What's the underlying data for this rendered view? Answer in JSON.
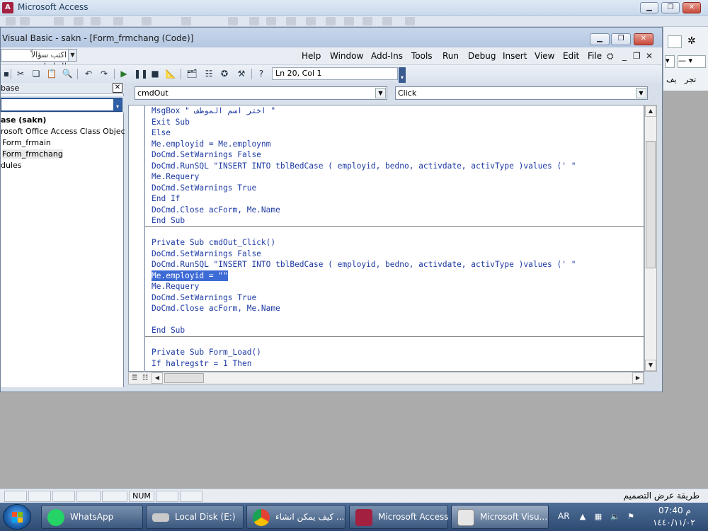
{
  "access": {
    "title": "Microsoft Access"
  },
  "vbe": {
    "title": "Visual Basic - sakn - [Form_frmchang (Code)]",
    "ask_placeholder": "اكتب سؤالاً للتعليمات",
    "menu": [
      "Help",
      "Window",
      "Add-Ins",
      "Tools",
      "Run",
      "Debug",
      "Insert",
      "View",
      "Edit",
      "File"
    ],
    "position": "Ln 20, Col 1"
  },
  "project": {
    "header": "base",
    "items": [
      "ase (sakn)",
      "rosoft Office Access Class Objects",
      "Form_frmain",
      "Form_frmchang",
      "dules"
    ]
  },
  "code": {
    "object_combo": "cmdOut",
    "procedure_combo": "Click",
    "lines": [
      "MsgBox \" اختر اسم الموظف \"",
      "Exit Sub",
      "Else",
      "Me.employid = Me.employnm",
      "DoCmd.SetWarnings False",
      "DoCmd.RunSQL \"INSERT INTO tblBedCase ( employid, bedno, activdate, activType )values (' \"",
      "Me.Requery",
      "DoCmd.SetWarnings True",
      "End If",
      "DoCmd.Close acForm, Me.Name",
      "End Sub",
      "",
      "Private Sub cmdOut_Click()",
      "DoCmd.SetWarnings False",
      "DoCmd.RunSQL \"INSERT INTO tblBedCase ( employid, bedno, activdate, activType )values (' \"",
      "Me.employid = \"\"",
      "Me.Requery",
      "DoCmd.SetWarnings True",
      "DoCmd.Close acForm, Me.Name",
      "",
      "End Sub",
      "",
      "Private Sub Form_Load()",
      "If halregstr = 1 Then"
    ]
  },
  "statusbar": {
    "num": "NUM",
    "view_name": "طريقة عرض التصميم"
  },
  "right_strip": {
    "text1": "يف",
    "text2": "تجر"
  },
  "taskbar": {
    "items": [
      {
        "label": "WhatsApp",
        "color": "#25d366"
      },
      {
        "label": "Local Disk (E:)",
        "color": "#c9c9c9"
      },
      {
        "label": "كيف يمكن انشاء ...",
        "color": "#e34133"
      },
      {
        "label": "Microsoft Access",
        "color": "#a32040"
      },
      {
        "label": "Microsoft Visu...",
        "color": "#e6e6e6"
      }
    ],
    "lang": "AR",
    "time": "07:40 م",
    "date": "١٤٤٠/١١/٠٢"
  }
}
